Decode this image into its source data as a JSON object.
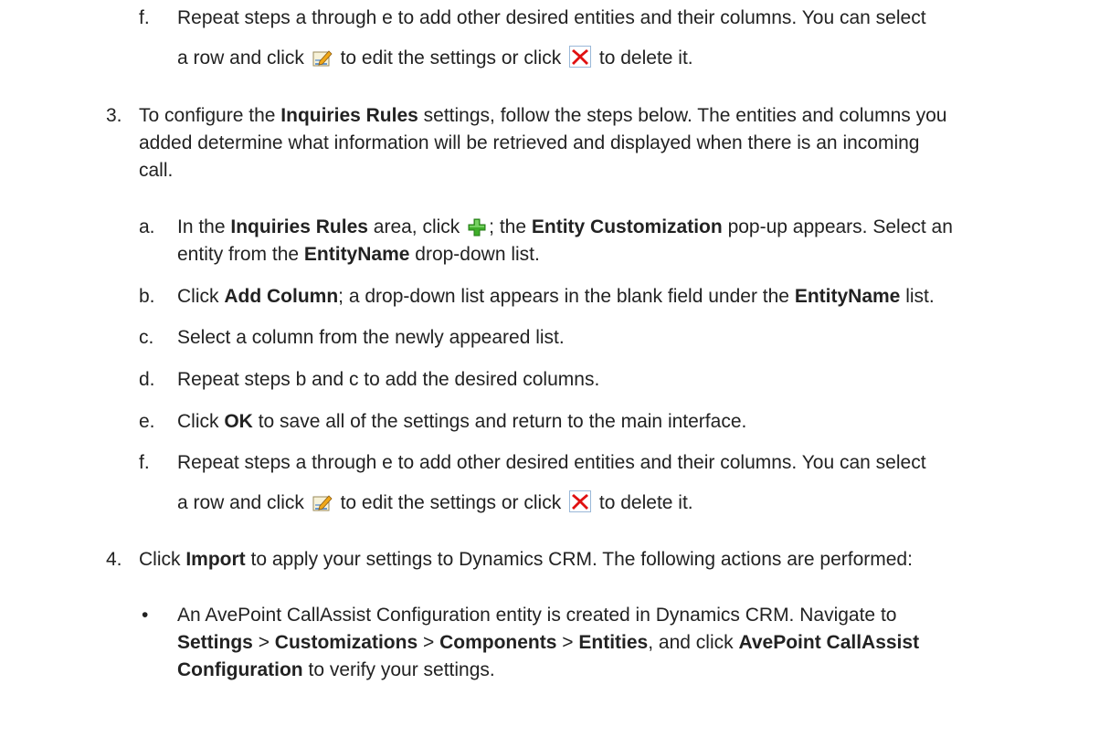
{
  "step2f": {
    "marker": "f.",
    "line1": "Repeat steps a through e to add other desired entities and their columns. You can select",
    "line2_pre": "a row and click",
    "line2_mid": "to edit the settings or click",
    "line2_post": "to delete it."
  },
  "step3": {
    "marker": "3.",
    "line1_pre": "To configure the",
    "line1_bold": "Inquiries Rules",
    "line1_post": "settings, follow the steps below. The entities and columns you",
    "line2": "added determine what information will be retrieved and displayed when there is an incoming",
    "line3": "call.",
    "a": {
      "marker": "a.",
      "t1": "In the",
      "b1": "Inquiries Rules",
      "t2": "area, click",
      "t3": "; the",
      "b2": "Entity Customization",
      "t4": "pop-up appears. Select an",
      "line2_pre": "entity from the",
      "line2_bold": "EntityName",
      "line2_post": "drop-down list."
    },
    "b": {
      "marker": "b.",
      "t1": "Click",
      "b1": "Add Column",
      "t2": "; a drop-down list appears in the blank field under the",
      "b2": "EntityName",
      "t3": "list."
    },
    "c": {
      "marker": "c.",
      "text": "Select a column from the newly appeared list."
    },
    "d": {
      "marker": "d.",
      "text": "Repeat steps b and c to add the desired columns."
    },
    "e": {
      "marker": "e.",
      "t1": "Click",
      "b1": "OK",
      "t2": "to save all of the settings and return to the main interface."
    },
    "f": {
      "marker": "f.",
      "line1": "Repeat steps a through e to add other desired entities and their columns. You can select",
      "line2_pre": "a row and click",
      "line2_mid": "to edit the settings or click",
      "line2_post": "to delete it."
    }
  },
  "step4": {
    "marker": "4.",
    "t1": "Click",
    "b1": "Import",
    "t2": "to apply your settings to Dynamics CRM. The following actions are performed:",
    "bullet": {
      "marker": "•",
      "line1": "An AvePoint CallAssist Configuration entity is created in Dynamics CRM. Navigate to",
      "l2_b1": "Settings",
      "l2_sep1": ">",
      "l2_b2": "Customizations",
      "l2_sep2": ">",
      "l2_b3": "Components",
      "l2_sep3": ">",
      "l2_b4": "Entities",
      "l2_t1": ", and click",
      "l2_b5": "AvePoint CallAssist",
      "l3_b1": "Configuration",
      "l3_t1": "to verify your settings."
    }
  },
  "icons": {
    "edit": "edit-icon",
    "delete": "delete-icon",
    "add": "add-icon",
    "delete_color": "#e01010",
    "add_color": "#3fae2a"
  }
}
